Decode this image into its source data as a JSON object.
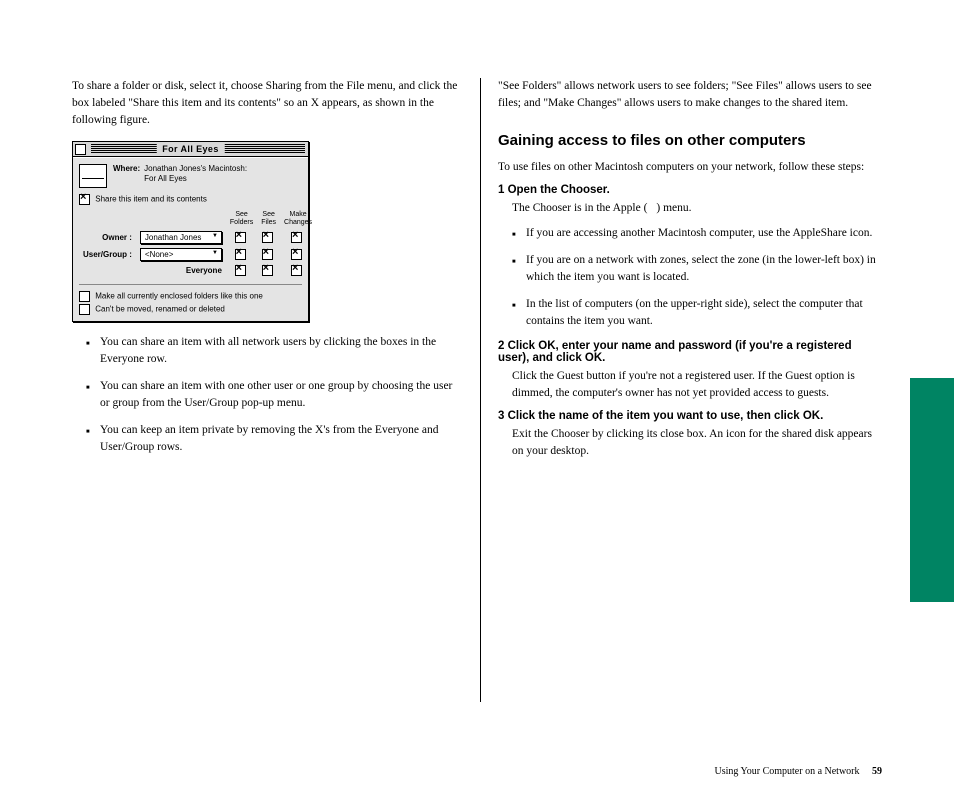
{
  "left": {
    "intro": "To share a folder or disk, select it, choose Sharing from the File menu, and click the box labeled \"Share this item and its contents\" so an X appears, as shown in the following figure.",
    "screenshot": {
      "title": "For All Eyes",
      "whereLabel": "Where:",
      "wherePath1": "Jonathan Jones's Macintosh:",
      "wherePath2": "For All Eyes",
      "shareLabel": "Share this item and its contents",
      "col1": "See Folders",
      "col2": "See Files",
      "col3": "Make Changes",
      "ownerLabel": "Owner :",
      "ownerValue": "Jonathan Jones",
      "groupLabel": "User/Group :",
      "groupValue": "<None>",
      "everyoneLabel": "Everyone",
      "footer1": "Make all currently enclosed folders like this one",
      "footer2": "Can't be moved, renamed or deleted"
    },
    "bullets": [
      "You can share an item with all network users by clicking the boxes in the Everyone row.",
      "You can share an item with one other user or one group by choosing the user or group from the User/Group pop-up menu.",
      "You can keep an item private by removing the X's from the Everyone and User/Group rows."
    ]
  },
  "right": {
    "p1": "\"See Folders\" allows network users to see folders; \"See Files\" allows users to see files; and \"Make Changes\" allows users to make changes to the shared item.",
    "heading": "Gaining access to files on other computers",
    "lead": "To use files on other Macintosh computers on your network, follow these steps:",
    "step1_label": "1 Open the Chooser.",
    "step1_body": "The Chooser is in the Apple () menu.",
    "steps": [
      "If you are accessing another Macintosh computer, use the AppleShare icon.",
      "If you are on a network with zones, select the zone (in the lower-left box) in which the item you want is located.",
      "In the list of computers (on the upper-right side), select the computer that contains the item you want."
    ],
    "step2_label": "2 Click OK, enter your name and password (if you're a registered user), and click OK.",
    "step2_body": "Click the Guest button if you're not a registered user. If the Guest option is dimmed, the computer's owner has not yet provided access to guests.",
    "step3_label": "3 Click the name of the item you want to use, then click OK.",
    "step3_body": "Exit the Chooser by clicking its close box. An icon for the shared disk appears on your desktop."
  },
  "footer": {
    "pageSection": "Using Your Computer on a Network",
    "pageNumber": "59"
  }
}
